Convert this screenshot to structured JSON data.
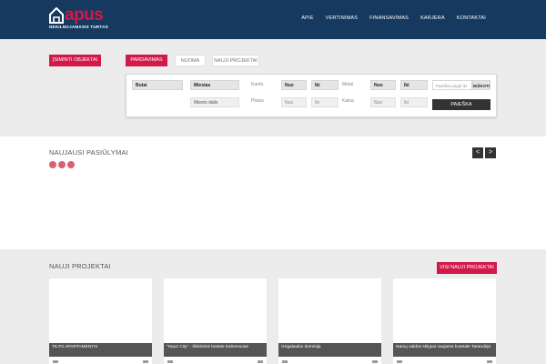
{
  "brand": {
    "name": "apus",
    "tagline": "NEKILNOJAMASIS TURTAS",
    "color": "#d11a4a"
  },
  "nav": {
    "items": [
      "APIE",
      "VERTINIMAS",
      "FINANSAVIMAS",
      "KARJERA",
      "KONTAKTAI"
    ]
  },
  "search": {
    "remembered_button": "ĮSIMINTI OBJEKTAI",
    "tabs": [
      "PARDAVIMAS",
      "NUOMA",
      "NAUJI PROJEKTAI"
    ],
    "type_select": "Butai",
    "city_select": "Miestas",
    "district_select": "Miesto dalis",
    "rooms_label": "Kamb.",
    "rooms_from": "Nuo",
    "rooms_to": "Iki",
    "area_label": "Plotas",
    "area_from": "Nuo",
    "area_to": "Iki",
    "year_label": "Metai",
    "year_from": "Nuo",
    "year_to": "Iki",
    "price_label": "Kaina",
    "price_from": "Nuo",
    "price_to": "Iki",
    "id_placeholder": "Paieška pagal ID",
    "id_button": "IEŠKOTI",
    "submit": "PAIEŠKA"
  },
  "latest": {
    "title": "NAUJAUSI PASIŪLYMAI",
    "prev": "<",
    "next": ">"
  },
  "projects": {
    "title": "NAUJI PROJEKTAI",
    "all_button": "VISI NAUJI PROJEKTAI",
    "cards": [
      {
        "caption": "TILTO APARTAMENTAI"
      },
      {
        "caption": "\"Hauz City\" - išskirtinis būstas Kalnenuose"
      },
      {
        "caption": "Grigalaukio dominija"
      },
      {
        "caption": "Namų valdos sklypai naujame kvartale Tarandėje"
      }
    ]
  },
  "colors": {
    "header": "#163a5f",
    "accent": "#d11a4a",
    "dark_button": "#333333"
  }
}
